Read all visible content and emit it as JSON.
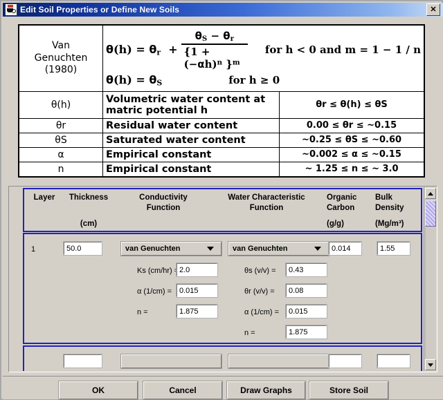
{
  "window": {
    "title": "Edit Soil Properties or Define New Soils",
    "icon": "java-coffee-cup-icon",
    "close_label": "✕"
  },
  "formula_table": {
    "rows": [
      {
        "symbol": "Van\nGenuchten\n(1980)",
        "symbol_lines": [
          "Van",
          "Genuchten",
          "(1980)"
        ],
        "equation_1": "θ(h) = θr + (θS − θr) / {1 + (−αh)ⁿ}ᵐ",
        "equation_1_lhs": "θ(h) = θ",
        "equation_1_lhs_sub": "r",
        "equation_1_plus": "+",
        "numerator_a": "θ",
        "numerator_a_sub": "S",
        "numerator_minus": "−",
        "numerator_b": "θ",
        "numerator_b_sub": "r",
        "denominator": "{1 + (−αh)",
        "denominator_sup_n": "n",
        "denominator_close": "}",
        "denominator_sup_m": "m",
        "condition_1": "for  h < 0  and  m = 1 − 1 / n",
        "equation_2_lhs": "θ(h) = θ",
        "equation_2_sub": "S",
        "condition_2": "for  h ≥ 0"
      },
      {
        "symbol": "θ(h)",
        "description": "Volumetric water content at matric potential h",
        "range": "θr ≤ θ(h) ≤ θS"
      },
      {
        "symbol": "θr",
        "description": "Residual water content",
        "range": "0.00 ≤ θr ≤ ~0.15"
      },
      {
        "symbol": "θS",
        "description": "Saturated water content",
        "range": "~0.25 ≤ θS ≤ ~0.60"
      },
      {
        "symbol": "α",
        "description": "Empirical constant",
        "range": "~0.002 ≤ α ≤ ~0.15"
      },
      {
        "symbol": "n",
        "description": "Empirical constant",
        "range": "~ 1.25 ≤ n ≤ ~ 3.0"
      }
    ]
  },
  "grid": {
    "headers": {
      "layer": "Layer",
      "thickness": "Thickness",
      "thickness_units": "(cm)",
      "conductivity_l1": "Conductivity",
      "conductivity_l2": "Function",
      "water_char_l1": "Water Characteristic",
      "water_char_l2": "Function",
      "organic_l1": "Organic",
      "organic_l2": "Carbon",
      "organic_units": "(g/g)",
      "bulk_l1": "Bulk",
      "bulk_l2": "Density",
      "bulk_units": "(Mg/m³)"
    },
    "row1": {
      "layer": "1",
      "thickness": "50.0",
      "conductivity_function": "van Genuchten",
      "water_char_function": "van Genuchten",
      "organic_carbon": "0.014",
      "bulk_density": "1.55",
      "cond_params": [
        {
          "label": "Ks (cm/hr) =",
          "value": "2.0"
        },
        {
          "label": "α (1/cm) =",
          "value": "0.015"
        },
        {
          "label": "n =",
          "value": "1.875"
        }
      ],
      "wc_params": [
        {
          "label": "θs (v/v) =",
          "value": "0.43"
        },
        {
          "label": "θr (v/v) =",
          "value": "0.08"
        },
        {
          "label": "α (1/cm) =",
          "value": "0.015"
        },
        {
          "label": "n =",
          "value": "1.875"
        }
      ]
    },
    "scrollbar": {
      "up": "▲",
      "down": "▼"
    }
  },
  "buttons": {
    "ok": "OK",
    "cancel": "Cancel",
    "draw_graphs": "Draw Graphs",
    "store_soil": "Store Soil"
  },
  "colors": {
    "title_bar_start": "#0a246a",
    "title_bar_end": "#c9dcf5",
    "panel_bg": "#d4d0c8",
    "grid_border": "#2222bb",
    "scroll_thumb": "#b0a8e8"
  }
}
